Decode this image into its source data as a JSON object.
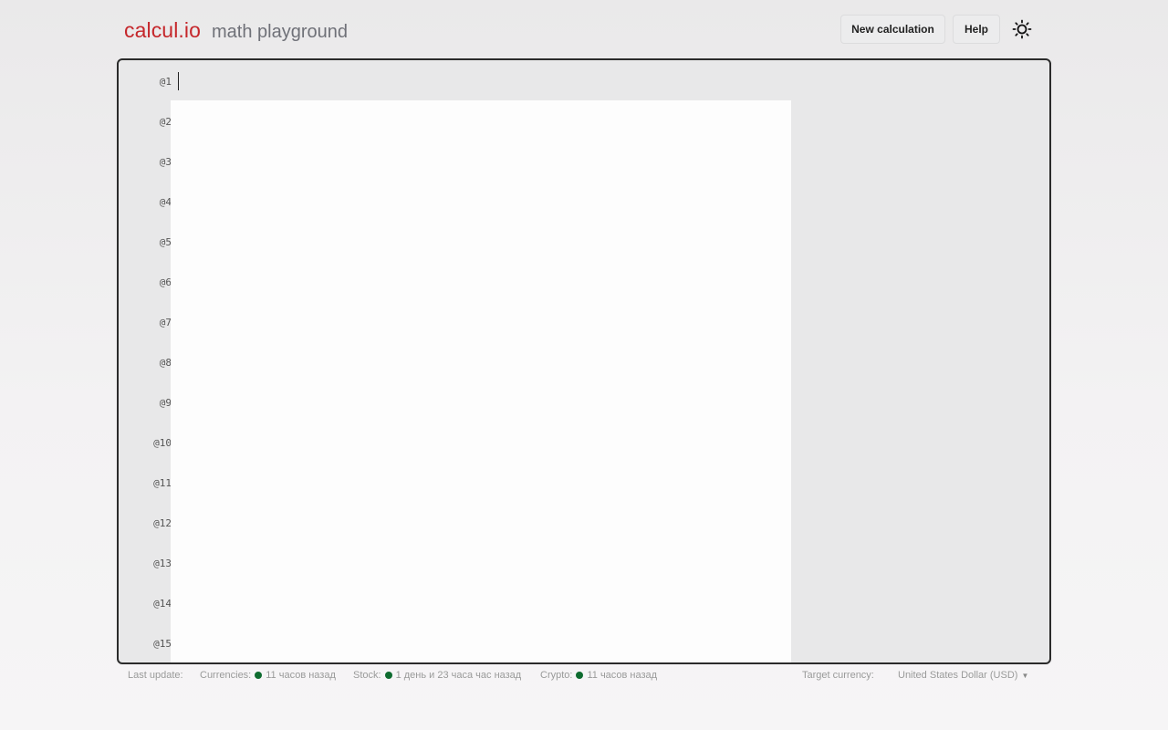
{
  "brand": {
    "name": "calcul.io",
    "subtitle": "math playground"
  },
  "toolbar": {
    "new_label": "New  calculation",
    "help_label": "Help"
  },
  "editor": {
    "line_numbers": [
      "@1",
      "@2",
      "@3",
      "@4",
      "@5",
      "@6",
      "@7",
      "@8",
      "@9",
      "@10",
      "@11",
      "@12",
      "@13",
      "@14",
      "@15"
    ]
  },
  "footer": {
    "last_update_label": "Last update:",
    "currencies_label": "Currencies:",
    "currencies_value": "11 часов назад",
    "stock_label": "Stock:",
    "stock_value": "1 день и 23 часа час назад",
    "crypto_label": "Crypto:",
    "crypto_value": "11 часов назад",
    "target_currency_label": "Target currency:",
    "target_currency_value": "United States Dollar (USD)"
  },
  "colors": {
    "brand": "#c5272b",
    "status_dot": "#0e6b2f",
    "frame_border": "#2b2b2b"
  },
  "icons": {
    "theme_toggle": "sun-icon",
    "dropdown": "caret-down-icon"
  }
}
